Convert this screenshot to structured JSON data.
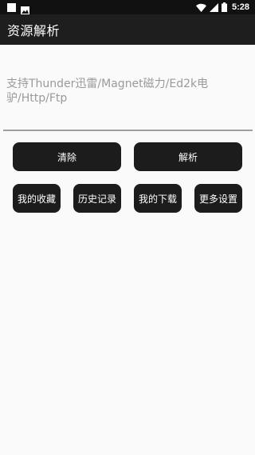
{
  "status_bar": {
    "time": "5:28",
    "icons": [
      "notification-square-icon",
      "image-icon",
      "wifi-icon",
      "signal-icon",
      "battery-icon"
    ]
  },
  "app_bar": {
    "title": "资源解析"
  },
  "input": {
    "placeholder": "支持Thunder迅雷/Magnet磁力/Ed2k电驴/Http/Ftp",
    "value": ""
  },
  "actions": {
    "clear_label": "清除",
    "parse_label": "解析"
  },
  "shortcuts": {
    "favorites_label": "我的收藏",
    "history_label": "历史记录",
    "downloads_label": "我的下载",
    "settings_label": "更多设置"
  },
  "colors": {
    "status_bar": "#111111",
    "app_bar": "#1e1e1e",
    "background": "#fafafa",
    "button": "#1c1c1c",
    "placeholder": "#9a9a9a",
    "underline": "#9e9e9e"
  }
}
